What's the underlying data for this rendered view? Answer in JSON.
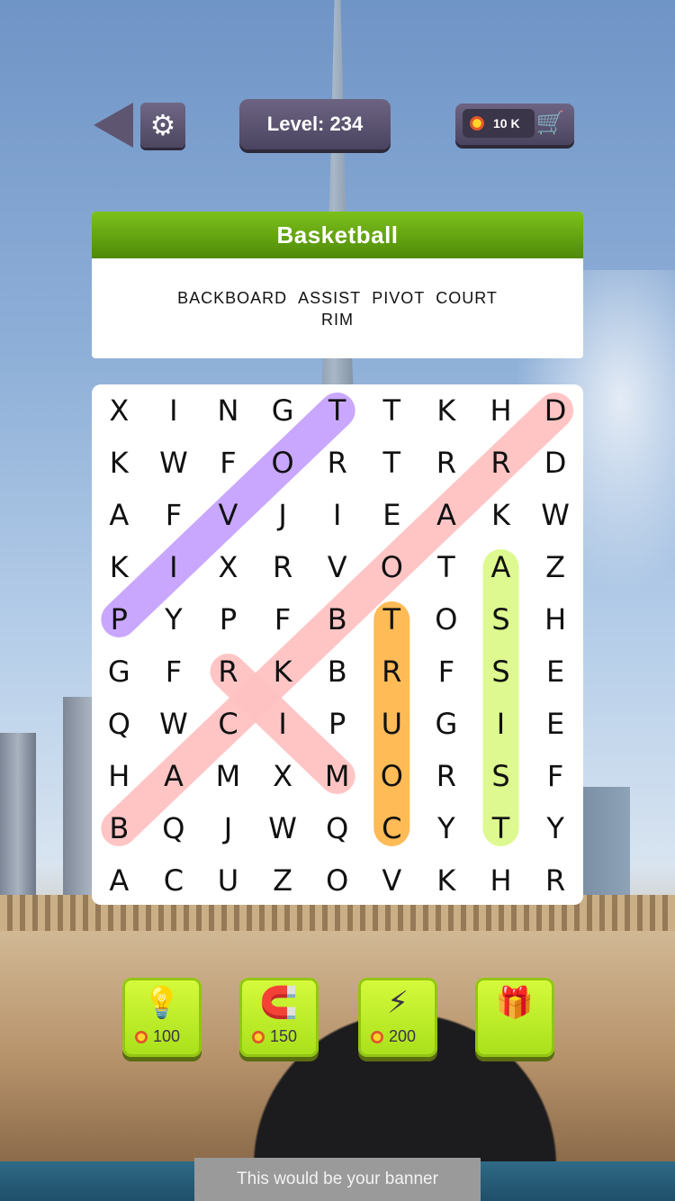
{
  "header": {
    "back_icon": "back-arrow-icon",
    "settings_icon": "gear-icon",
    "level_text": "Level: 234",
    "coins_text": "10 K",
    "cart_icon": "cart-icon"
  },
  "category": {
    "title": "Basketball",
    "words": [
      "BACKBOARD",
      "ASSIST",
      "PIVOT",
      "COURT",
      "RIM"
    ]
  },
  "grid": {
    "rows": [
      [
        "X",
        "I",
        "N",
        "G",
        "T",
        "T",
        "K",
        "H",
        "D"
      ],
      [
        "K",
        "W",
        "F",
        "O",
        "R",
        "T",
        "R",
        "R",
        "D"
      ],
      [
        "A",
        "F",
        "V",
        "J",
        "I",
        "E",
        "A",
        "K",
        "W"
      ],
      [
        "K",
        "I",
        "X",
        "R",
        "V",
        "O",
        "T",
        "A",
        "Z"
      ],
      [
        "P",
        "Y",
        "P",
        "F",
        "B",
        "T",
        "O",
        "S",
        "H"
      ],
      [
        "G",
        "F",
        "R",
        "K",
        "B",
        "R",
        "F",
        "S",
        "E"
      ],
      [
        "Q",
        "W",
        "C",
        "I",
        "P",
        "U",
        "G",
        "I",
        "E"
      ],
      [
        "H",
        "A",
        "M",
        "X",
        "M",
        "O",
        "R",
        "S",
        "F"
      ],
      [
        "B",
        "Q",
        "J",
        "W",
        "Q",
        "C",
        "Y",
        "T",
        "Y"
      ],
      [
        "A",
        "C",
        "U",
        "Z",
        "O",
        "V",
        "K",
        "H",
        "R"
      ]
    ],
    "found": [
      {
        "word": "PIVOT",
        "from": [
          4,
          0
        ],
        "to": [
          0,
          4
        ],
        "color": "#c7a3ff"
      },
      {
        "word": "BACKBOARD",
        "from": [
          8,
          0
        ],
        "to": [
          0,
          8
        ],
        "color": "#ffc2c2"
      },
      {
        "word": "RIM",
        "from": [
          5,
          2
        ],
        "to": [
          7,
          4
        ],
        "color": "#ffc2c2"
      },
      {
        "word": "COURT",
        "from": [
          8,
          5
        ],
        "to": [
          4,
          5
        ],
        "color": "#ffb84d"
      },
      {
        "word": "ASSIST",
        "from": [
          3,
          7
        ],
        "to": [
          8,
          7
        ],
        "color": "#dcf98a"
      }
    ]
  },
  "powerups": [
    {
      "icon": "lightbulb-icon",
      "cost": "100"
    },
    {
      "icon": "magnet-icon",
      "cost": "150"
    },
    {
      "icon": "lightning-icon",
      "cost": "200"
    },
    {
      "icon": "gift-video-icon",
      "cost": ""
    }
  ],
  "banner": {
    "text": "This would be your banner"
  }
}
